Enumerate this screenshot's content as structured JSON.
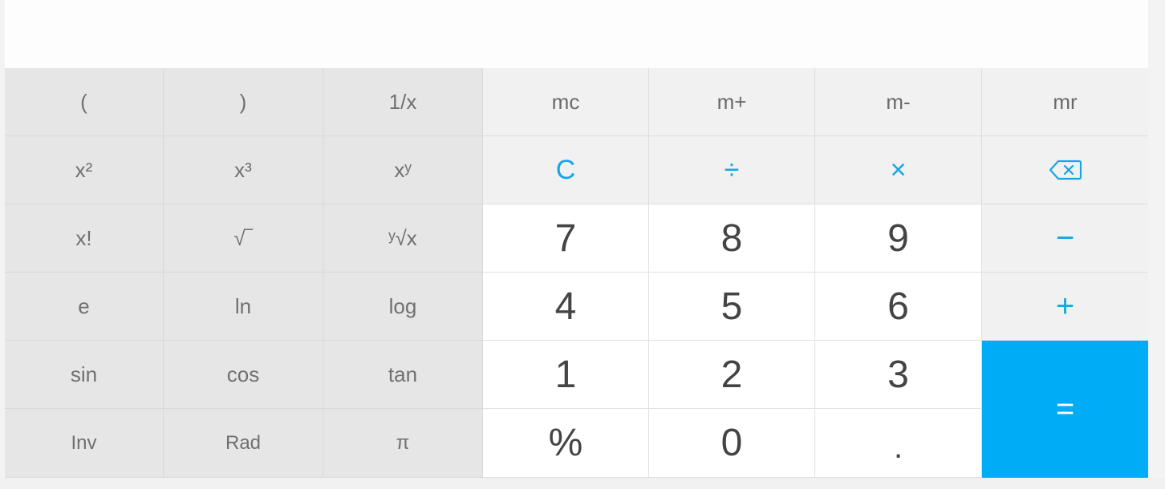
{
  "display": {
    "value": ""
  },
  "scientific": {
    "row1": [
      "(",
      ")",
      "1/x"
    ],
    "row2": [
      "x²",
      "x³",
      "xʸ"
    ],
    "row3": [
      "x!",
      "√‾",
      "ʸ√x"
    ],
    "row4": [
      "e",
      "ln",
      "log"
    ],
    "row5": [
      "sin",
      "cos",
      "tan"
    ],
    "row6": [
      "Inv",
      "Rad",
      "π"
    ]
  },
  "memory": [
    "mc",
    "m+",
    "m-",
    "mr"
  ],
  "operators": {
    "clear": "C",
    "divide": "÷",
    "multiply": "×",
    "backspace_icon": "backspace-icon",
    "minus": "−",
    "plus": "+",
    "equals": "="
  },
  "digits": {
    "row1": [
      "7",
      "8",
      "9"
    ],
    "row2": [
      "4",
      "5",
      "6"
    ],
    "row3": [
      "1",
      "2",
      "3"
    ],
    "row4": [
      "%",
      "0",
      "."
    ]
  },
  "colors": {
    "accent": "#14a7e8",
    "equals_bg": "#00acf5"
  }
}
